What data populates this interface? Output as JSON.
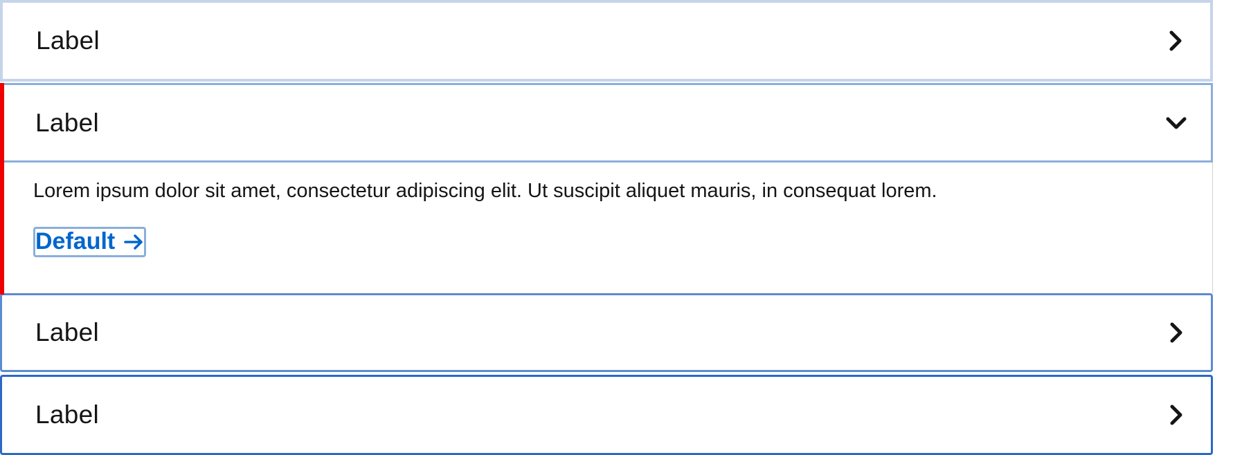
{
  "accordion": {
    "items": [
      {
        "label": "Label",
        "expanded": false,
        "icon": "chevron-right-icon"
      },
      {
        "label": "Label",
        "expanded": true,
        "icon": "chevron-down-icon",
        "content": {
          "text": "Lorem ipsum dolor sit amet, consectetur adipiscing elit. Ut suscipit aliquet mauris, in consequat lorem.",
          "link_label": "Default",
          "link_icon": "arrow-right-icon"
        }
      },
      {
        "label": "Label",
        "expanded": false,
        "icon": "chevron-right-icon"
      },
      {
        "label": "Label",
        "expanded": false,
        "icon": "chevron-right-icon"
      }
    ]
  },
  "colors": {
    "text": "#151515",
    "link": "#0066cc",
    "accent_red": "#ee0000",
    "focus_border_light": "#c6d4ea",
    "focus_border_mid": "#8aaedc",
    "focus_border_strong": "#2a6ac4"
  }
}
